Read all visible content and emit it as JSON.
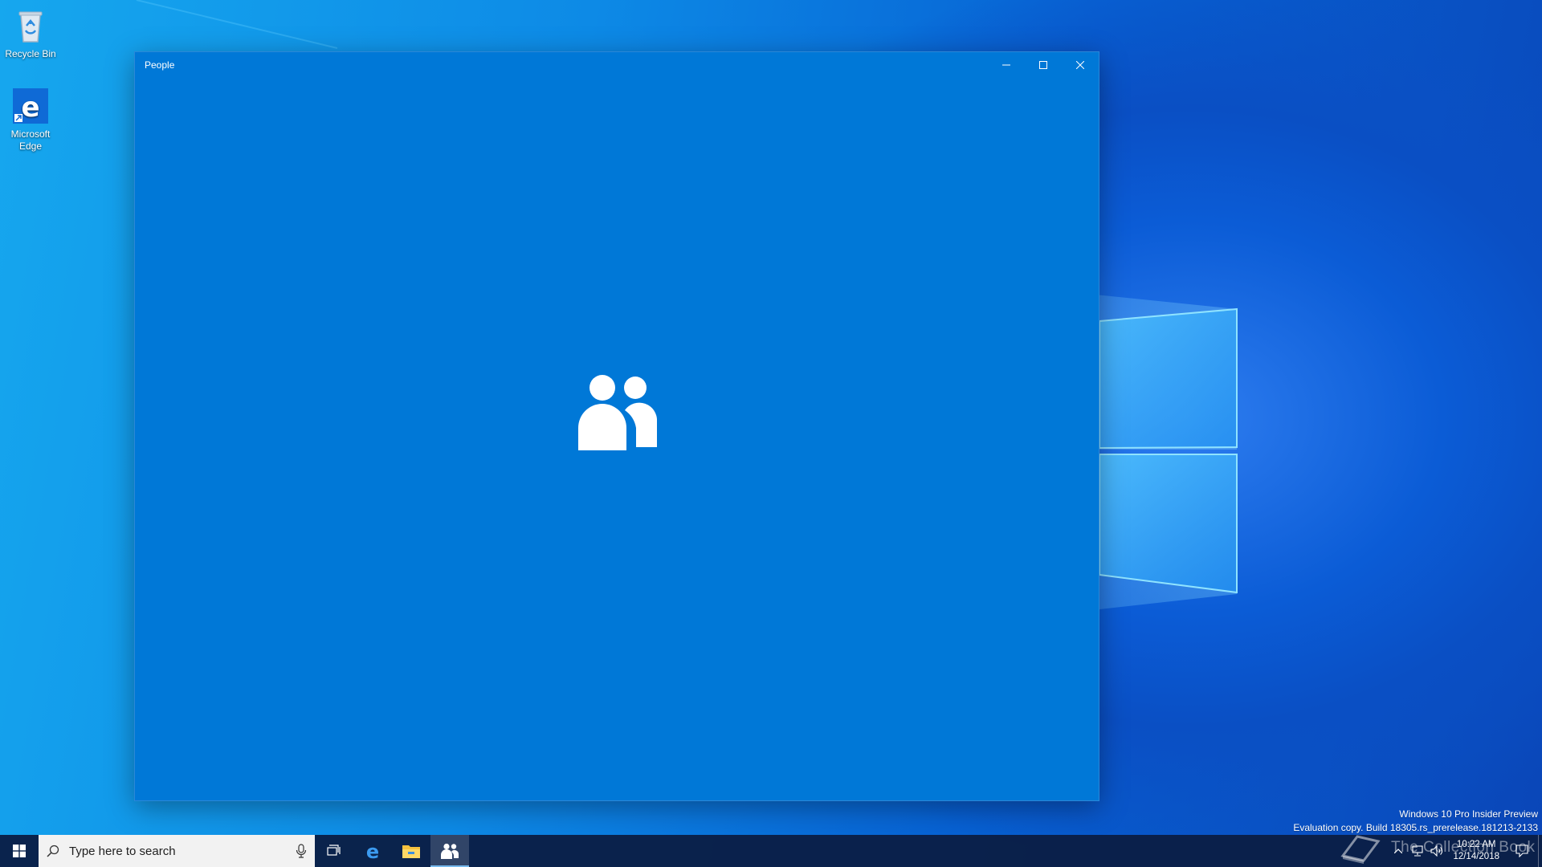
{
  "desktop": {
    "icons": [
      {
        "label": "Recycle Bin"
      },
      {
        "label": "Microsoft Edge"
      }
    ]
  },
  "window": {
    "title": "People",
    "minimize": "minimize-icon",
    "maximize": "maximize-icon",
    "close": "close-icon",
    "splash_icon": "people-icon",
    "background": "#0078d7"
  },
  "taskbar": {
    "start_icon": "windows-logo-icon",
    "search_placeholder": "Type here to search",
    "pinned": [
      "task-view-icon",
      "edge-icon",
      "file-explorer-icon",
      "people-icon"
    ],
    "active_app": "People",
    "clock_time": "10:22 AM",
    "clock_date": "12/14/2018"
  },
  "watermark": {
    "line1": "Windows 10 Pro Insider Preview",
    "line2": "Evaluation copy. Build 18305.rs_prerelease.181213-2133"
  },
  "brand": {
    "text": "The Collection Book"
  },
  "colors": {
    "accent": "#0078d7",
    "taskbar": "#0a1e46",
    "search_bg": "#f2f2f2"
  }
}
